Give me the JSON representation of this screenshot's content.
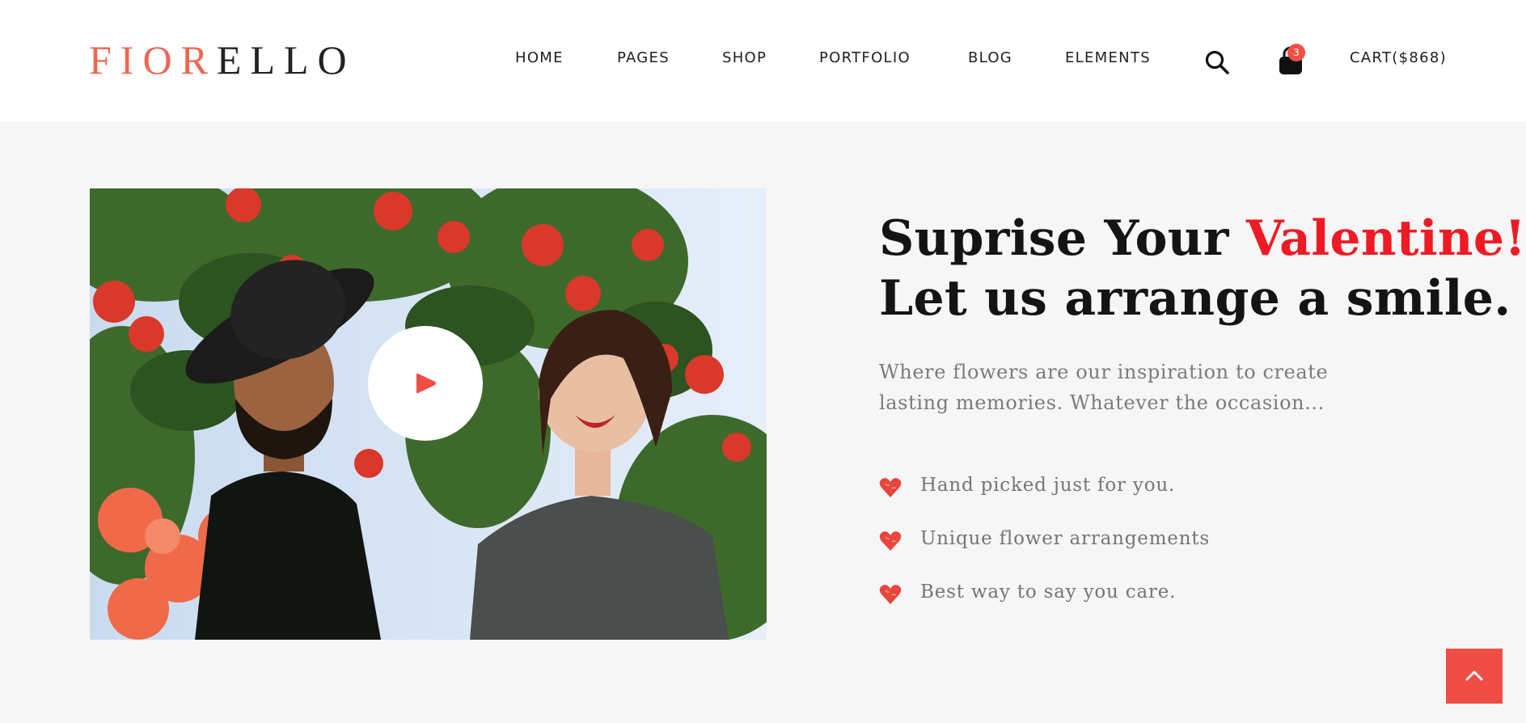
{
  "header": {
    "logo": {
      "part_a": "FIOR",
      "part_b": "ELLO"
    },
    "nav": {
      "home": "HOME",
      "pages": "PAGES",
      "shop": "SHOP",
      "portfolio": "PORTFOLIO",
      "blog": "BLOG",
      "elements": "ELEMENTS"
    },
    "search_icon": "search-icon",
    "bag_icon": "shopping-bag-icon",
    "cart_count": "3",
    "cart_label": "CART($868)"
  },
  "hero": {
    "image_icon": "couple-photo",
    "play_icon": "play-icon",
    "headline_part1": "Suprise Your ",
    "headline_accent": "Valentine!",
    "headline_line2": "Let us arrange a smile.",
    "intro": "Where flowers are our inspiration to create lasting memories. Whatever the occasion...",
    "features": [
      {
        "icon": "heart-icon",
        "text": "Hand picked just for you."
      },
      {
        "icon": "heart-icon",
        "text": "Unique flower arrangements"
      },
      {
        "icon": "heart-icon",
        "text": "Best way to say you care."
      }
    ]
  },
  "scroll_top": {
    "icon": "chevron-up-icon"
  },
  "colors": {
    "accent": "#ee1b24",
    "logo_accent": "#f06552",
    "button": "#f04e45",
    "page_bg": "#f6f6f6",
    "header_bg": "#ffffff"
  }
}
